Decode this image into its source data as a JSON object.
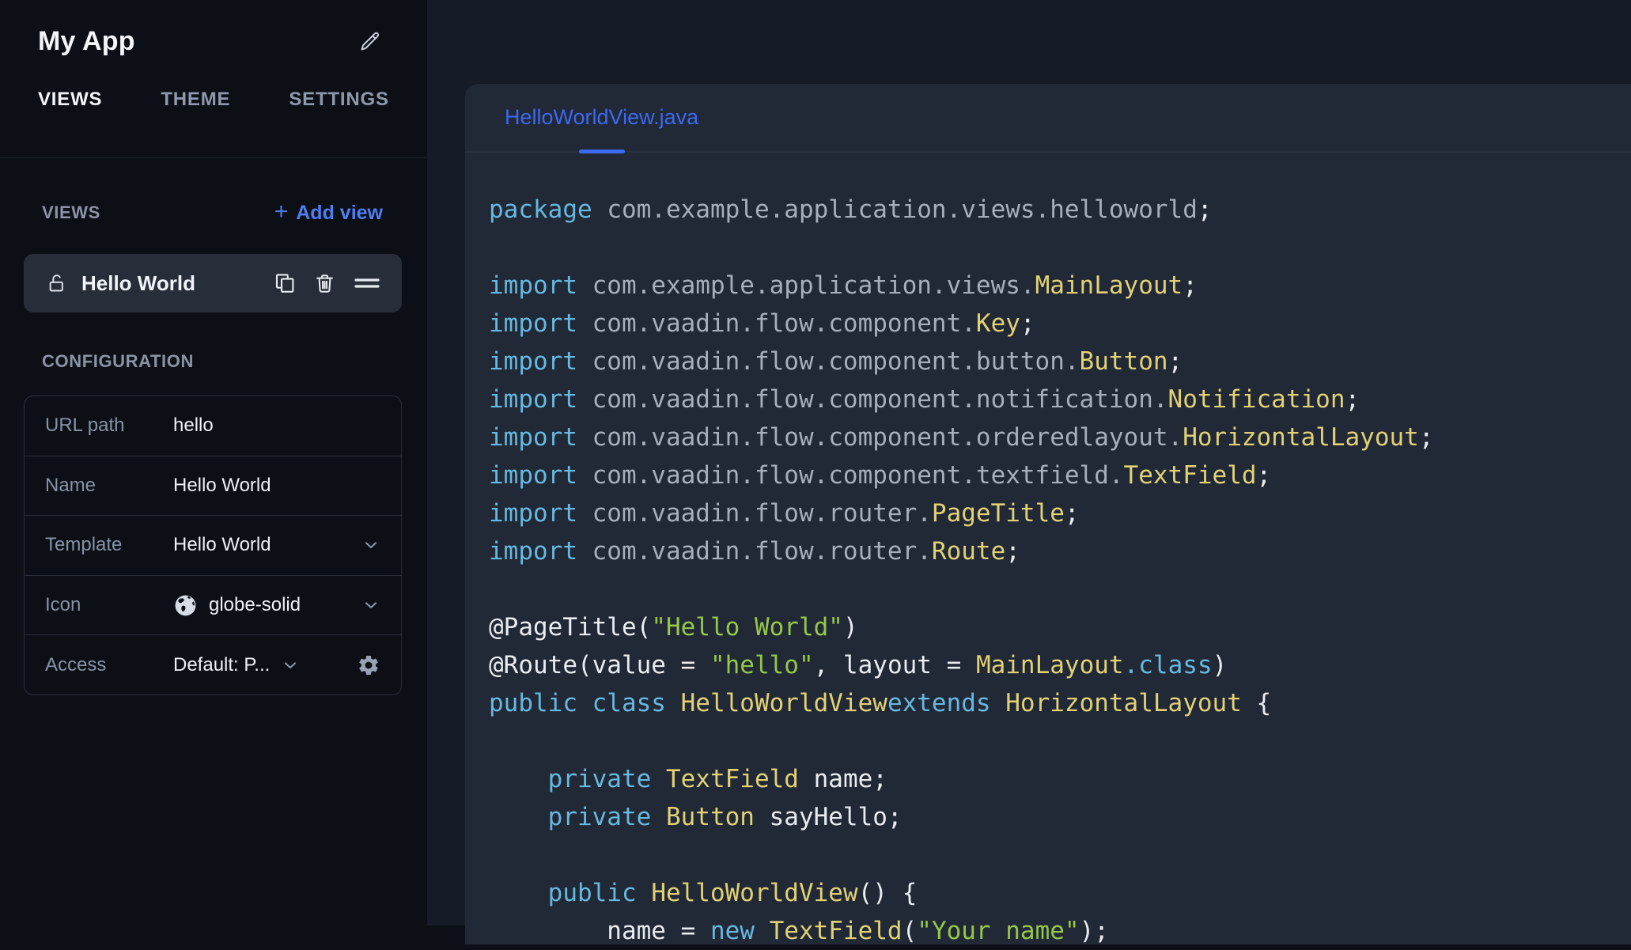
{
  "sidebar": {
    "app_title": "My App",
    "tabs": [
      {
        "label": "VIEWS",
        "active": true
      },
      {
        "label": "THEME",
        "active": false
      },
      {
        "label": "SETTINGS",
        "active": false
      }
    ],
    "views_section": {
      "title": "VIEWS",
      "plus": "+",
      "add_view_label": "Add view"
    },
    "view_item": {
      "label": "Hello World",
      "locked": false
    },
    "configuration": {
      "title": "CONFIGURATION",
      "rows": [
        {
          "label": "URL path",
          "value": "hello"
        },
        {
          "label": "Name",
          "value": "Hello World"
        },
        {
          "label": "Template",
          "value": "Hello World"
        },
        {
          "label": "Icon",
          "value": "globe-solid",
          "icon": "globe-icon"
        },
        {
          "label": "Access",
          "value": "Default: P..."
        }
      ]
    }
  },
  "editor": {
    "tab_label": "HelloWorldView.java",
    "code_lines": [
      [
        [
          "kw",
          "package"
        ],
        [
          "pl",
          " com.example.application.views.helloworld"
        ],
        [
          "wh",
          ";"
        ]
      ],
      [],
      [
        [
          "kw",
          "import"
        ],
        [
          "pl",
          " com.example.application.views."
        ],
        [
          "cls",
          "MainLayout"
        ],
        [
          "wh",
          ";"
        ]
      ],
      [
        [
          "kw",
          "import"
        ],
        [
          "pl",
          " com.vaadin.flow.component."
        ],
        [
          "cls",
          "Key"
        ],
        [
          "wh",
          ";"
        ]
      ],
      [
        [
          "kw",
          "import"
        ],
        [
          "pl",
          " com.vaadin.flow.component.button."
        ],
        [
          "cls",
          "Button"
        ],
        [
          "wh",
          ";"
        ]
      ],
      [
        [
          "kw",
          "import"
        ],
        [
          "pl",
          " com.vaadin.flow.component.notification."
        ],
        [
          "cls",
          "Notification"
        ],
        [
          "wh",
          ";"
        ]
      ],
      [
        [
          "kw",
          "import"
        ],
        [
          "pl",
          " com.vaadin.flow.component.orderedlayout."
        ],
        [
          "cls",
          "HorizontalLayout"
        ],
        [
          "wh",
          ";"
        ]
      ],
      [
        [
          "kw",
          "import"
        ],
        [
          "pl",
          " com.vaadin.flow.component.textfield."
        ],
        [
          "cls",
          "TextField"
        ],
        [
          "wh",
          ";"
        ]
      ],
      [
        [
          "kw",
          "import"
        ],
        [
          "pl",
          " com.vaadin.flow.router."
        ],
        [
          "cls",
          "PageTitle"
        ],
        [
          "wh",
          ";"
        ]
      ],
      [
        [
          "kw",
          "import"
        ],
        [
          "pl",
          " com.vaadin.flow.router."
        ],
        [
          "cls",
          "Route"
        ],
        [
          "wh",
          ";"
        ]
      ],
      [],
      [
        [
          "wh",
          "@PageTitle("
        ],
        [
          "str",
          "\"Hello World\""
        ],
        [
          "wh",
          ")"
        ]
      ],
      [
        [
          "wh",
          "@Route(value = "
        ],
        [
          "str",
          "\"hello\""
        ],
        [
          "wh",
          ", layout = "
        ],
        [
          "cls",
          "MainLayout"
        ],
        [
          "kw",
          ".class"
        ],
        [
          "wh",
          ")"
        ]
      ],
      [
        [
          "kw",
          "public class "
        ],
        [
          "cls",
          "HelloWorldView"
        ],
        [
          "kw",
          "extends "
        ],
        [
          "cls",
          "HorizontalLayout"
        ],
        [
          "wh",
          " {"
        ]
      ],
      [],
      [
        [
          "wh",
          "    "
        ],
        [
          "kw",
          "private "
        ],
        [
          "cls",
          "TextField"
        ],
        [
          "wh",
          " name;"
        ]
      ],
      [
        [
          "wh",
          "    "
        ],
        [
          "kw",
          "private "
        ],
        [
          "cls",
          "Button"
        ],
        [
          "wh",
          " sayHello;"
        ]
      ],
      [],
      [
        [
          "wh",
          "    "
        ],
        [
          "kw",
          "public "
        ],
        [
          "cls",
          "HelloWorldView"
        ],
        [
          "wh",
          "() {"
        ]
      ],
      [
        [
          "wh",
          "        name = "
        ],
        [
          "kw",
          "new "
        ],
        [
          "cls",
          "TextField"
        ],
        [
          "wh",
          "("
        ],
        [
          "str",
          "\"Your name\""
        ],
        [
          "wh",
          ");"
        ]
      ]
    ]
  },
  "colors": {
    "sidebar_bg": "#0c0f16",
    "main_bg": "#151b27",
    "panel_bg": "#212836",
    "item_bg": "#272d39",
    "accent_tab_blue": "#3d69f0",
    "accent_add_view_blue": "#4d7ef2",
    "slate_text": "#8b93a5",
    "white_text": "#f0f3f8",
    "code_keyword": "#66b9e0",
    "code_class": "#e2d175",
    "code_string": "#95c848",
    "code_plain": "#a6afba",
    "code_text": "#e9ecf1"
  }
}
